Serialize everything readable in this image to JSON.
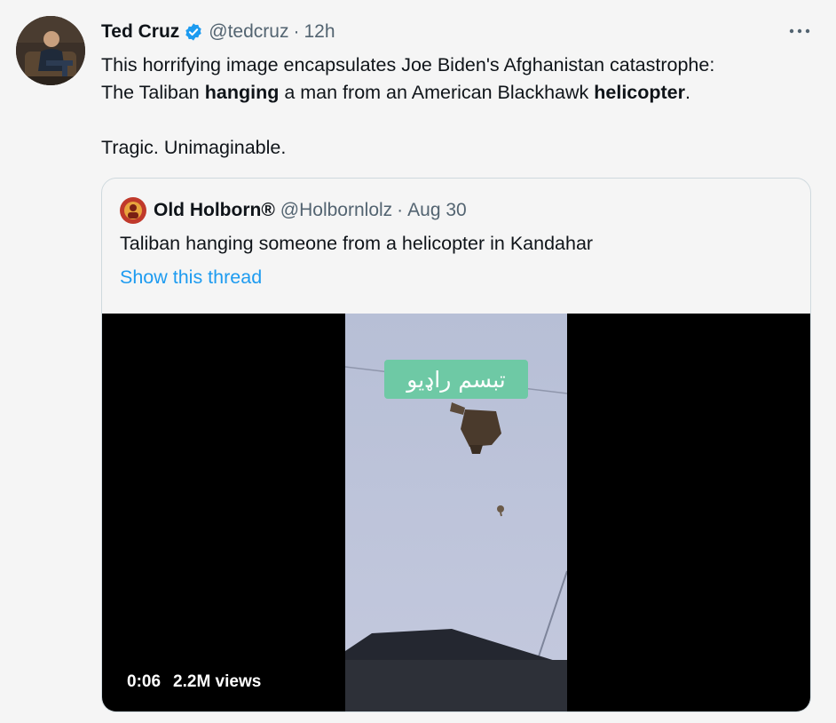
{
  "tweet": {
    "author_name": "Ted Cruz",
    "author_handle": "@tedcruz",
    "separator": "·",
    "time": "12h",
    "avatar_icon": "user-avatar-photo",
    "verified_icon": "verified-badge-icon",
    "more_icon": "more-options-icon",
    "text": {
      "line1": "This horrifying image encapsulates Joe Biden's Afghanistan catastrophe:",
      "line2_a": "The Taliban ",
      "line2_b": "hanging",
      "line2_c": " a man from an American Blackhawk ",
      "line2_d": "helicopter",
      "line2_e": ".",
      "line3": "Tragic. Unimaginable."
    }
  },
  "quoted": {
    "author_name": "Old Holborn®",
    "author_handle": "@Holbornlolz",
    "separator": "·",
    "time": "Aug 30",
    "text": "Taliban hanging someone from a helicopter in Kandahar",
    "show_thread": "Show this thread",
    "media": {
      "overlay_caption": "تبسم راډیو",
      "duration": "0:06",
      "views": "2.2M views"
    }
  },
  "colors": {
    "background": "#f5f5f5",
    "verified_blue": "#1d9bf0",
    "link_blue": "#1d9bf0",
    "secondary_text": "#536471",
    "caption_green": "#6ec9a5"
  }
}
